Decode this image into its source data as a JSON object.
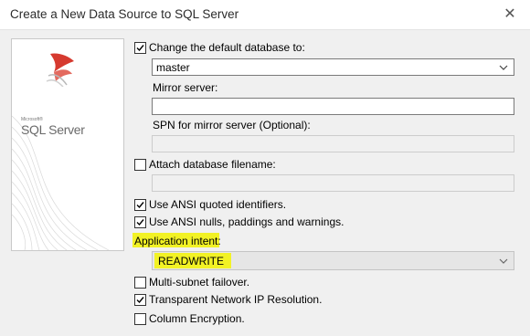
{
  "window": {
    "title": "Create a New Data Source to SQL Server",
    "close_glyph": "✕"
  },
  "logo": {
    "small_text": "Microsoft®",
    "product_text": "SQL Server",
    "icon": "sql-server-logo-icon"
  },
  "options": {
    "change_default_db": {
      "label": "Change the default database to:",
      "checked": true
    },
    "default_db_value": "master",
    "mirror_server": {
      "label": "Mirror server:",
      "value": ""
    },
    "spn_mirror": {
      "label": "SPN for mirror server (Optional):",
      "value": ""
    },
    "attach_db": {
      "label": "Attach database filename:",
      "checked": false,
      "value": ""
    },
    "ansi_quoted": {
      "label": "Use ANSI quoted identifiers.",
      "checked": true
    },
    "ansi_nulls": {
      "label": "Use ANSI nulls, paddings and warnings.",
      "checked": true
    },
    "application_intent": {
      "label": "Application intent:",
      "value": "READWRITE"
    },
    "multi_subnet": {
      "label": "Multi-subnet failover.",
      "checked": false
    },
    "transparent_ip": {
      "label": "Transparent Network IP Resolution.",
      "checked": true
    },
    "column_encryption": {
      "label": "Column Encryption.",
      "checked": false
    }
  },
  "colors": {
    "highlight": "#f2f225",
    "check": "#000000"
  }
}
